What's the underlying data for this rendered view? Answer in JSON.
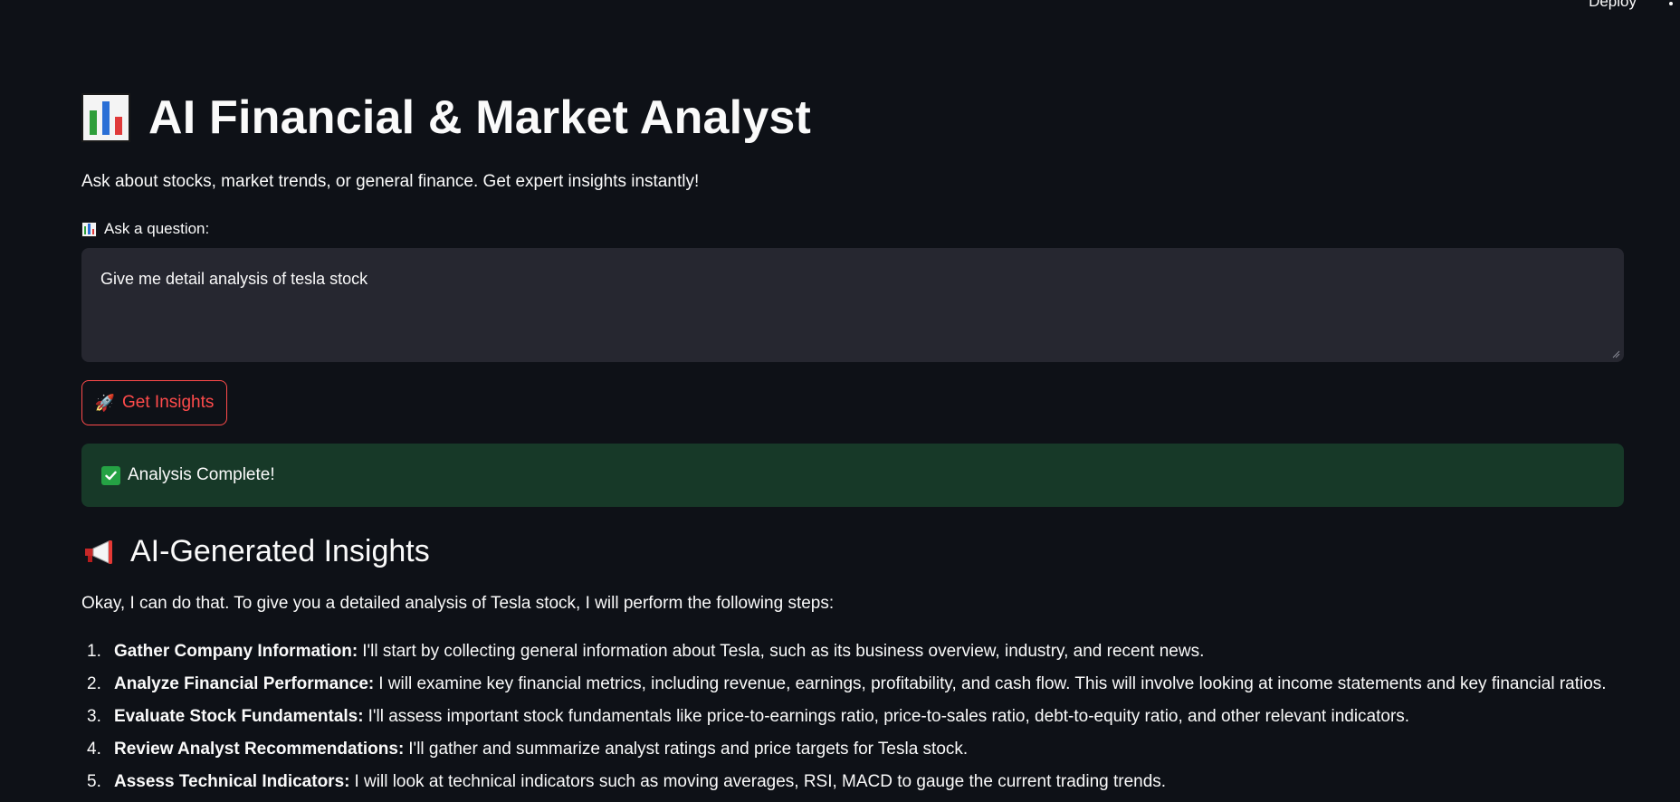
{
  "topbar": {
    "deploy_label": "Deploy"
  },
  "header": {
    "title": "AI Financial & Market Analyst",
    "subtitle": "Ask about stocks, market trends, or general finance. Get expert insights instantly!"
  },
  "question": {
    "label": "Ask a question:",
    "value": "Give me detail analysis of tesla stock"
  },
  "button": {
    "label": "Get Insights",
    "icon": "rocket-icon"
  },
  "status": {
    "message": "Analysis Complete!",
    "color": "#173928"
  },
  "insights": {
    "heading": "AI-Generated Insights",
    "intro": "Okay, I can do that. To give you a detailed analysis of Tesla stock, I will perform the following steps:",
    "steps": [
      {
        "num": "1.",
        "title": "Gather Company Information:",
        "text": "I'll start by collecting general information about Tesla, such as its business overview, industry, and recent news."
      },
      {
        "num": "2.",
        "title": "Analyze Financial Performance:",
        "text": "I will examine key financial metrics, including revenue, earnings, profitability, and cash flow. This will involve looking at income statements and key financial ratios."
      },
      {
        "num": "3.",
        "title": "Evaluate Stock Fundamentals:",
        "text": "I'll assess important stock fundamentals like price-to-earnings ratio, price-to-sales ratio, debt-to-equity ratio, and other relevant indicators."
      },
      {
        "num": "4.",
        "title": "Review Analyst Recommendations:",
        "text": "I'll gather and summarize analyst ratings and price targets for Tesla stock."
      },
      {
        "num": "5.",
        "title": "Assess Technical Indicators:",
        "text": "I will look at technical indicators such as moving averages, RSI, MACD to gauge the current trading trends."
      }
    ]
  },
  "colors": {
    "background": "#0e1117",
    "accent": "#ff4b4b",
    "input_bg": "#262730"
  }
}
